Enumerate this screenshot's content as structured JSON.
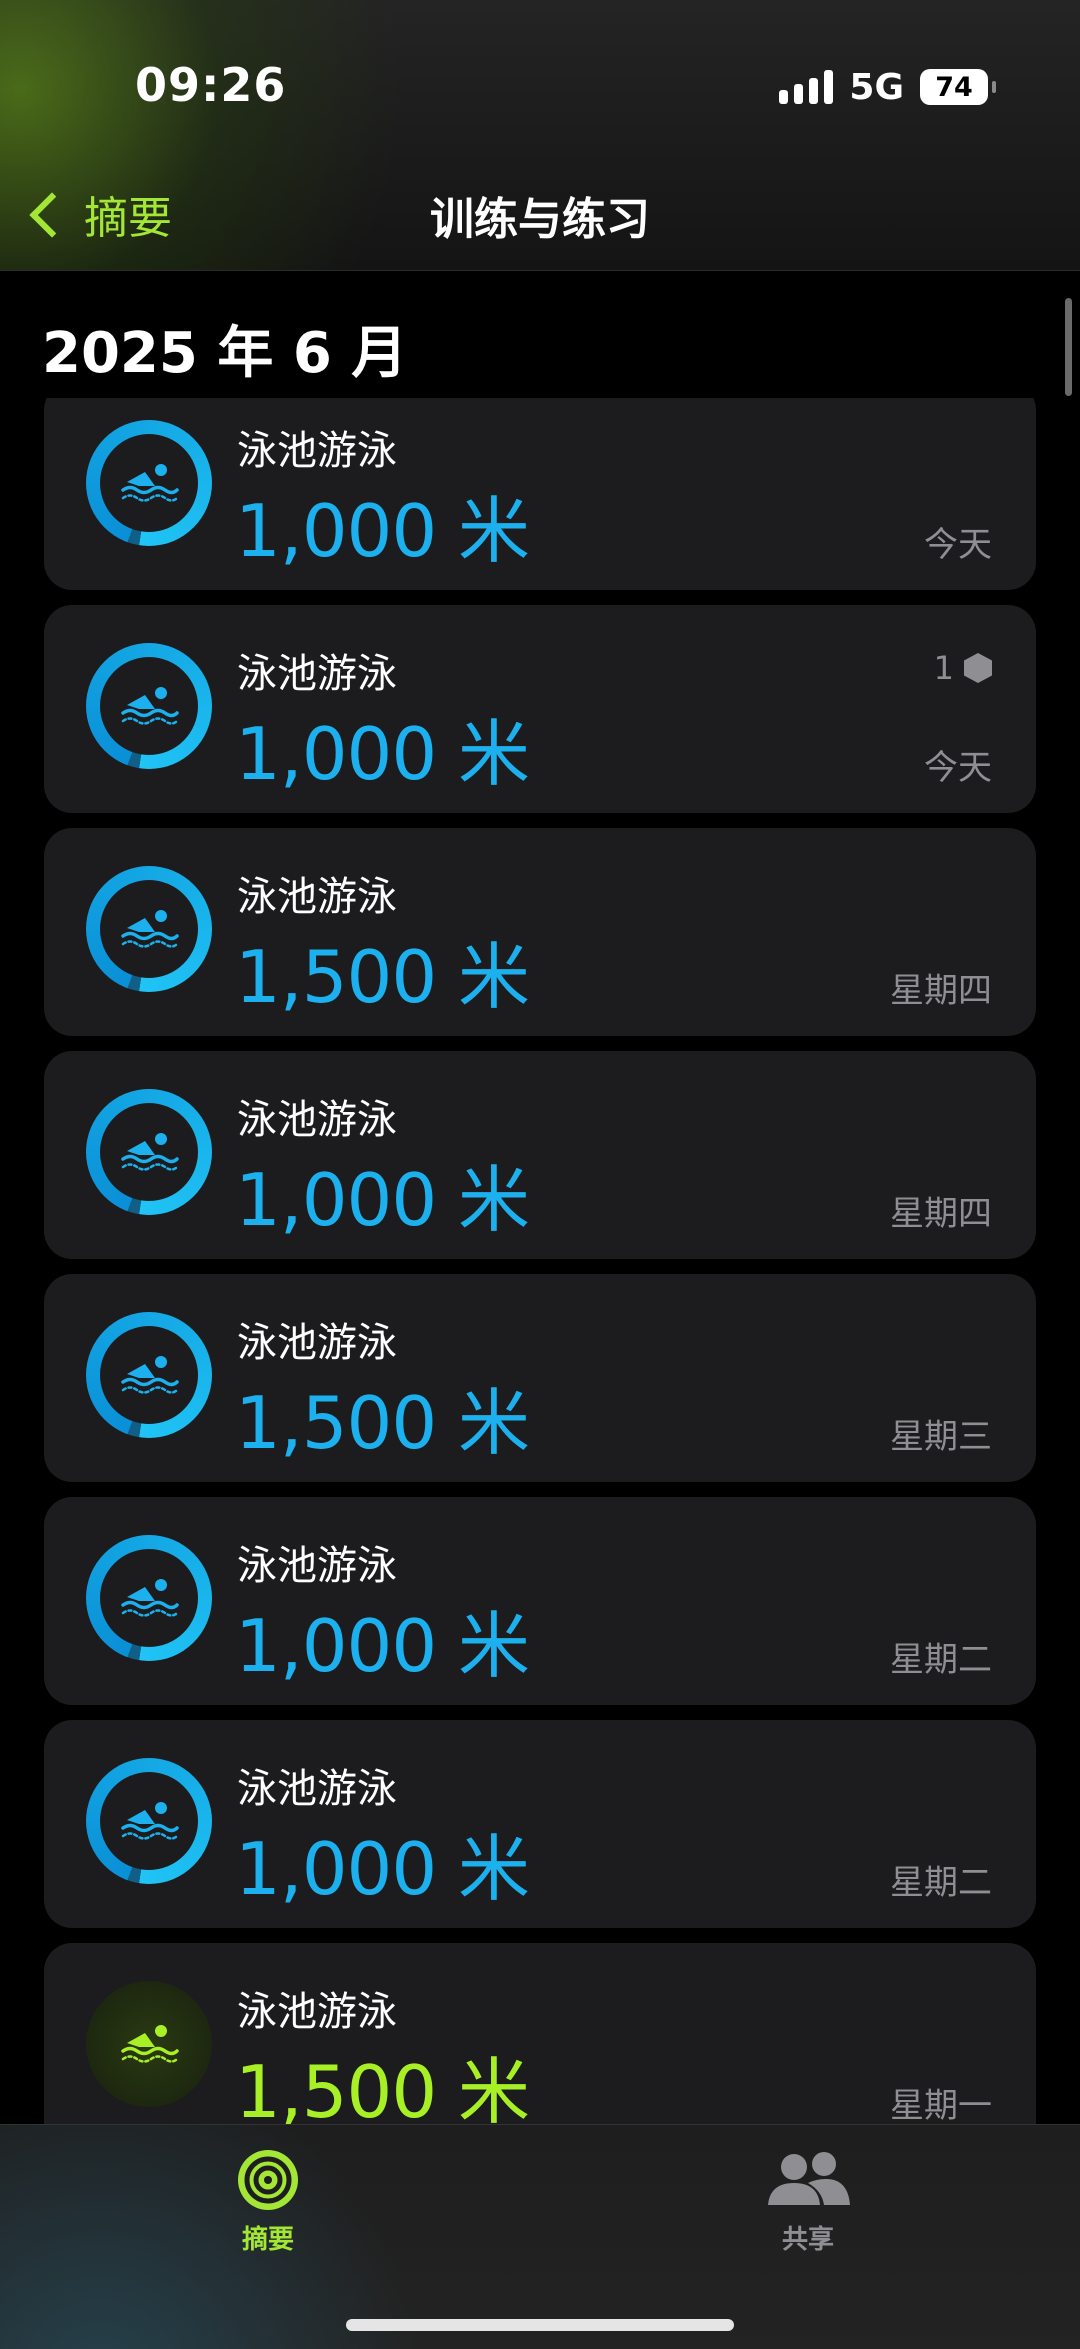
{
  "status_bar": {
    "time": "09:26",
    "network": "5G",
    "battery": "74"
  },
  "nav": {
    "back_label": "摘要",
    "title": "训练与练习"
  },
  "section": {
    "title": "2025 年 6 月"
  },
  "workouts": [
    {
      "title": "泳池游泳",
      "value": "1,000 米",
      "date": "今天",
      "ring_fraction": 0.97,
      "color": "#1cb1ee"
    },
    {
      "title": "泳池游泳",
      "value": "1,000 米",
      "date": "今天",
      "badge": "1",
      "ring_fraction": 0.97,
      "color": "#1cb1ee"
    },
    {
      "title": "泳池游泳",
      "value": "1,500 米",
      "date": "星期四",
      "ring_fraction": 0.97,
      "color": "#1cb1ee"
    },
    {
      "title": "泳池游泳",
      "value": "1,000 米",
      "date": "星期四",
      "ring_fraction": 0.97,
      "color": "#1cb1ee"
    },
    {
      "title": "泳池游泳",
      "value": "1,500 米",
      "date": "星期三",
      "ring_fraction": 0.97,
      "color": "#1cb1ee"
    },
    {
      "title": "泳池游泳",
      "value": "1,000 米",
      "date": "星期二",
      "ring_fraction": 0.97,
      "color": "#1cb1ee"
    },
    {
      "title": "泳池游泳",
      "value": "1,000 米",
      "date": "星期二",
      "ring_fraction": 0.97,
      "color": "#1cb1ee"
    },
    {
      "title": "泳池游泳",
      "value": "1,500 米",
      "date": "星期一",
      "ring_fraction": 0,
      "color": "#a8f026"
    }
  ],
  "tabs": [
    {
      "label": "摘要",
      "icon": "activity-rings-icon",
      "active": true
    },
    {
      "label": "共享",
      "icon": "people-icon",
      "active": false
    }
  ],
  "colors": {
    "accent": "#a3e635",
    "swim": "#1cb1ee"
  }
}
